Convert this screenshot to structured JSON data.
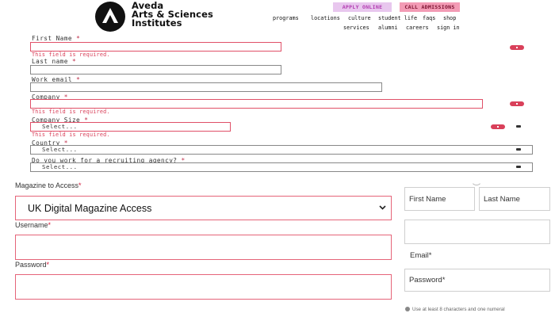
{
  "header": {
    "logo_lines": [
      "Aveda",
      "Arts & Sciences",
      "Institutes"
    ],
    "apply_label": "APPLY ONLINE",
    "call_label": "CALL ADMISSIONS",
    "nav_primary": [
      "programs",
      "locations",
      "culture",
      "student life",
      "faqs",
      "shop"
    ],
    "nav_secondary": [
      "services",
      "alumni",
      "careers",
      "sign in"
    ],
    "colors": {
      "apply_bg": "#e8c7ee",
      "call_bg": "#f39bb5",
      "error": "#d9405a"
    }
  },
  "upper_form": {
    "first_name_label": "First Name",
    "last_name_label": "Last name",
    "work_email_label": "Work email",
    "company_label": "Company",
    "company_size_label": "Company Size",
    "country_label": "Country",
    "recruiting_label": "Do you work for a recruiting agency?",
    "required_mark": "*",
    "error_text": "This field is required.",
    "select_placeholder": "Select..."
  },
  "lower_form": {
    "magazine_label": "Magazine to Access",
    "magazine_value": "UK Digital Magazine Access",
    "username_label": "Username",
    "password_label": "Password",
    "required_mark": "*"
  },
  "right_form": {
    "first_name_placeholder": "First Name",
    "last_name_placeholder": "Last Name",
    "email_label": "Email*",
    "password_placeholder": "Password*",
    "password_hint": "Use at least 8 characters and one numeral"
  }
}
